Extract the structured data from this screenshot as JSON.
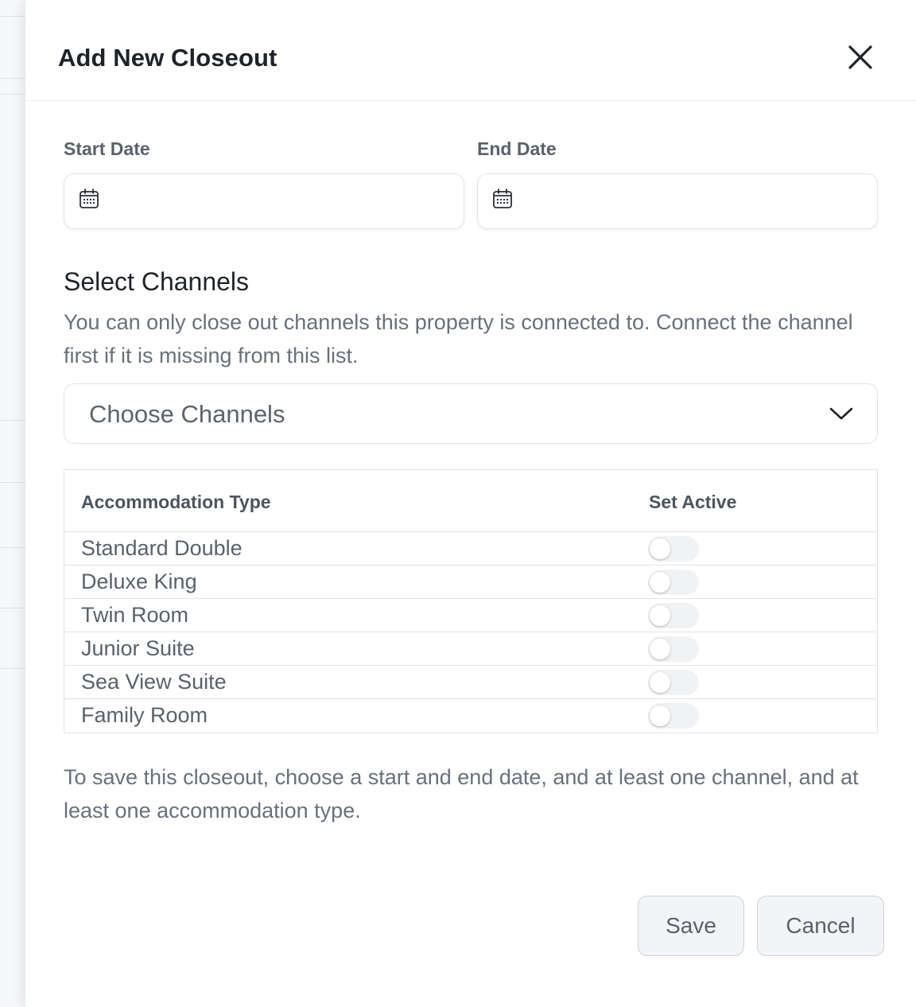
{
  "modal": {
    "title": "Add New Closeout"
  },
  "dates": {
    "start_label": "Start Date",
    "end_label": "End Date",
    "start_value": "",
    "end_value": ""
  },
  "channels": {
    "title": "Select Channels",
    "description": "You can only close out channels this property is connected to. Connect the channel first if it is missing from this list.",
    "placeholder": "Choose Channels"
  },
  "accommodation_table": {
    "col_type": "Accommodation Type",
    "col_active": "Set Active",
    "rows": [
      {
        "name": "Standard Double",
        "active": false
      },
      {
        "name": "Deluxe King",
        "active": false
      },
      {
        "name": "Twin Room",
        "active": false
      },
      {
        "name": "Junior Suite",
        "active": false
      },
      {
        "name": "Sea View Suite",
        "active": false
      },
      {
        "name": "Family Room",
        "active": false
      }
    ]
  },
  "hint": "To save this closeout, choose a start and end date, and at least one channel, and at least one accommodation type.",
  "actions": {
    "save_label": "Save",
    "cancel_label": "Cancel"
  }
}
